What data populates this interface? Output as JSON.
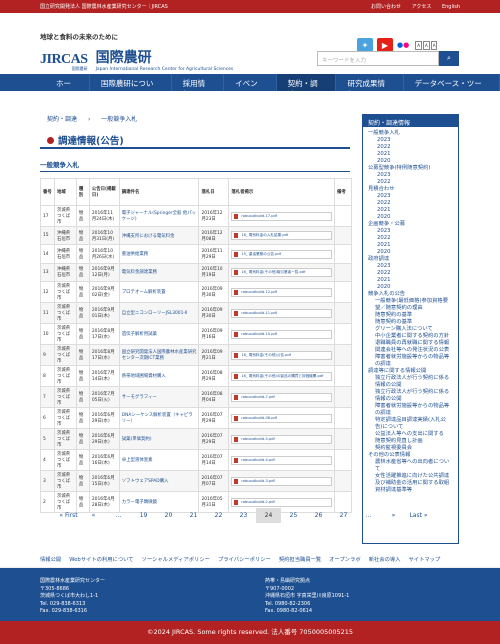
{
  "topbar": {
    "org": "国立研究開発法人 国際農林水産業研究センター｜JIRCAS",
    "links": [
      "お問い合わせ",
      "アクセス",
      "English"
    ]
  },
  "header": {
    "tagline": "地球と食料の未来のために",
    "logo": "JIRCAS",
    "logo_sub": "国際農研",
    "org_jp": "国際農研",
    "org_en": "Japan International Research Center for Agricultural Sciences"
  },
  "search": {
    "placeholder": "キーワードを入力"
  },
  "nav": [
    "ホーム",
    "国際農研について",
    "採用情報",
    "イベント",
    "契約・調達",
    "研究成果情報",
    "データベース・ツール"
  ],
  "breadcrumb": [
    "契約・調達",
    "一般競争入札"
  ],
  "page_title": "調達情報(公告)",
  "section_title": "一般競争入札",
  "table": {
    "headers": [
      "番号",
      "地域",
      "種別",
      "公告日(掲載日)",
      "調達件名",
      "落札日",
      "落札者掲示",
      "備考"
    ],
    "rows": [
      [
        "17",
        "茨城県つくば市",
        "物品",
        "2016年11月24日(木)",
        "電子ジャーナル(Springer全般 他パッケージ)",
        "2016年12月23日",
        "robuoutbuild-17.pdf",
        "",
        ""
      ],
      [
        "15",
        "沖縄県石垣市",
        "物品",
        "2016年10月31日(月)",
        "沖縄支所における電気料金",
        "2016年12月08日",
        "16_ 電気料金の入札結果.pdf",
        "",
        ""
      ],
      [
        "14",
        "沖縄県石垣市",
        "物品",
        "2016年10月26日(水)",
        "重油供給業務",
        "2016年11月29日",
        "15_ 重油業務の公告.pdf",
        "",
        ""
      ],
      [
        "13",
        "沖縄県石垣市",
        "物品",
        "2016年9月12日(月)",
        "電気料金調達業務",
        "2016年10月19日",
        "16_ 電気料金(その他)取引業者一覧.pdf",
        "",
        ""
      ],
      [
        "12",
        "茨城県つくば市",
        "物品",
        "2016年9月02日(金)",
        "プロテオーム解析装置",
        "2016年09月30日",
        "robuoutbuild-12.pdf",
        "",
        ""
      ],
      [
        "11",
        "茨城県つくば市",
        "物品",
        "2016年9月01日(木)",
        "自立型ニコンローリーJSL3001-Ⅱ",
        "2016年09月30日",
        "robuoutbuild-11.pdf",
        "",
        ""
      ],
      [
        "10",
        "茨城県つくば市",
        "物品",
        "2016年8月17日(水)",
        "遺伝子解析用試薬",
        "2016年09月16日",
        "robuoutbuild-10.pdf",
        "",
        ""
      ],
      [
        "9",
        "茨城県つくば市",
        "物品",
        "2016年8月17日(水)",
        "国立研究開発法人国際農林水産業研究センター次期ICT業務",
        "2016年09月21日",
        "16_ 電気料金(その他)公告.pdf",
        "",
        ""
      ],
      [
        "8",
        "茨城県つくば市",
        "物品",
        "2016年7月14日(木)",
        "熱帯地域圃場資材購入",
        "2016年08月29日",
        "16_ 電気料金(その他)の製品の購買と評価機関.pdf",
        "",
        ""
      ],
      [
        "7",
        "茨城県つくば市",
        "物品",
        "2016年7月05日(火)",
        "サーモグラフィー",
        "2016年08月04日",
        "robuoutbuild-7.pdf",
        "",
        ""
      ],
      [
        "6",
        "茨城県つくば市",
        "物品",
        "2016年6月29日(水)",
        "DNAシーケンス解析装置（キャピラリー）",
        "2016年07月29日",
        "robuoutbuild-06.pdf",
        "",
        ""
      ],
      [
        "5",
        "茨城県つくば市",
        "物品",
        "2016年6月29日(水)",
        "試薬(単価契約)",
        "2016年07月29日",
        "robuoutbuild-5.pdf",
        "",
        ""
      ],
      [
        "4",
        "茨城県つくば市",
        "物品",
        "2016年6月16日(木)",
        "卓上型液体窒素",
        "2016年07月14日",
        "robuoutbuild-4.pdf",
        "",
        ""
      ],
      [
        "3",
        "茨城県つくば市",
        "物品",
        "2016年6月15日(水)",
        "ソフトウェアSPAD購入",
        "2016年07月07日",
        "robuoutbuild-3.pdf",
        "",
        ""
      ],
      [
        "2",
        "茨城県つくば市",
        "物品",
        "2016年4月28日(木)",
        "カラー電子顕微鏡",
        "2016年05月31日",
        "robuoutbuild-2.pdf",
        "",
        ""
      ]
    ]
  },
  "pager": [
    "« First",
    "«",
    "...",
    "19",
    "20",
    "21",
    "22",
    "23",
    "24",
    "25",
    "26",
    "27",
    "...",
    "»",
    "Last »"
  ],
  "sidebar": {
    "title": "契約・調達情報",
    "items": [
      {
        "t": "一般競争入札",
        "c": "l1"
      },
      {
        "t": "2023",
        "c": "l2"
      },
      {
        "t": "2022",
        "c": "l2"
      },
      {
        "t": "2021",
        "c": "l2"
      },
      {
        "t": "2020",
        "c": "l2"
      },
      {
        "t": "公募型競争(特例随意契約)",
        "c": "l1"
      },
      {
        "t": "2023",
        "c": "l2"
      },
      {
        "t": "2022",
        "c": "l2"
      },
      {
        "t": "見積合わせ",
        "c": "l1"
      },
      {
        "t": "2023",
        "c": "l2"
      },
      {
        "t": "2022",
        "c": "l2"
      },
      {
        "t": "2021",
        "c": "l2"
      },
      {
        "t": "2020",
        "c": "l2"
      },
      {
        "t": "企画競争・公募",
        "c": "l1"
      },
      {
        "t": "2023",
        "c": "l2"
      },
      {
        "t": "2022",
        "c": "l2"
      },
      {
        "t": "2021",
        "c": "l2"
      },
      {
        "t": "2020",
        "c": "l2"
      },
      {
        "t": "政府調達",
        "c": "l1"
      },
      {
        "t": "2023",
        "c": "l2"
      },
      {
        "t": "2022",
        "c": "l2"
      },
      {
        "t": "2021",
        "c": "l2"
      },
      {
        "t": "2020",
        "c": "l2"
      },
      {
        "t": "競争入札の公告",
        "c": "l1"
      },
      {
        "t": "一般競争(最低価格)参加資格要望／随意契約の理由",
        "c": "l3"
      },
      {
        "t": "随意契約の基準",
        "c": "l3"
      },
      {
        "t": "随意契約の基準",
        "c": "l3"
      },
      {
        "t": "グリーン購入法について",
        "c": "l3"
      },
      {
        "t": "中小企業者に関する契約の方針",
        "c": "l3"
      },
      {
        "t": "退職職員の再就職に関する情報",
        "c": "l3"
      },
      {
        "t": "関連会社等への発注状況の公表",
        "c": "l3"
      },
      {
        "t": "障害者就労施設等からの物品等の調達",
        "c": "l3"
      },
      {
        "t": "調達等に関する情報公開",
        "c": "l1"
      },
      {
        "t": "独立行政法人が行う契約に係る情報の公開",
        "c": "l3"
      },
      {
        "t": "独立行政法人が行う契約に係る情報の公開",
        "c": "l3"
      },
      {
        "t": "障害者就労施設等からの物品等の調達",
        "c": "l3"
      },
      {
        "t": "特定調達品目調達実績(入札公告)について",
        "c": "l3"
      },
      {
        "t": "公益法人等への支出に関する",
        "c": "l3"
      },
      {
        "t": "随意契約見直し計画",
        "c": "l3"
      },
      {
        "t": "契約監視委員会",
        "c": "l3"
      },
      {
        "t": "その他の公表情報",
        "c": "l1"
      },
      {
        "t": "農林水産省等への出向者について",
        "c": "l3"
      },
      {
        "t": "女性活躍推進に向けた公共調達及び補助金の活用に関する取組",
        "c": "l3"
      },
      {
        "t": "資材調達基準等",
        "c": "l3"
      }
    ]
  },
  "footlinks": [
    "情報公開",
    "Webサイトの利用について",
    "ソーシャルメディアポリシー",
    "プライバシーポリシー",
    "契約担当職員一覧",
    "オープンラボ",
    "新社会の導入",
    "サイトマップ"
  ],
  "footer": {
    "left": [
      "国際農林水産業研究センター",
      "〒305-8686",
      "茨城県つくば市大わし1-1",
      "Tel. 029-838-6313",
      "Fax. 029-838-6316"
    ],
    "right": [
      "熱帯・島嶼研究拠点",
      "〒907-0002",
      "沖縄県石垣市 字真栄里川良原1091-1",
      "Tel. 0980-82-2306",
      "Fax. 0980-82-0614"
    ]
  },
  "copyright": "©2024 JIRCAS. Some rights reserved. 法人番号 7050005005215",
  "colors": {
    "brand": "#1d4f91",
    "accent": "#b22222"
  }
}
